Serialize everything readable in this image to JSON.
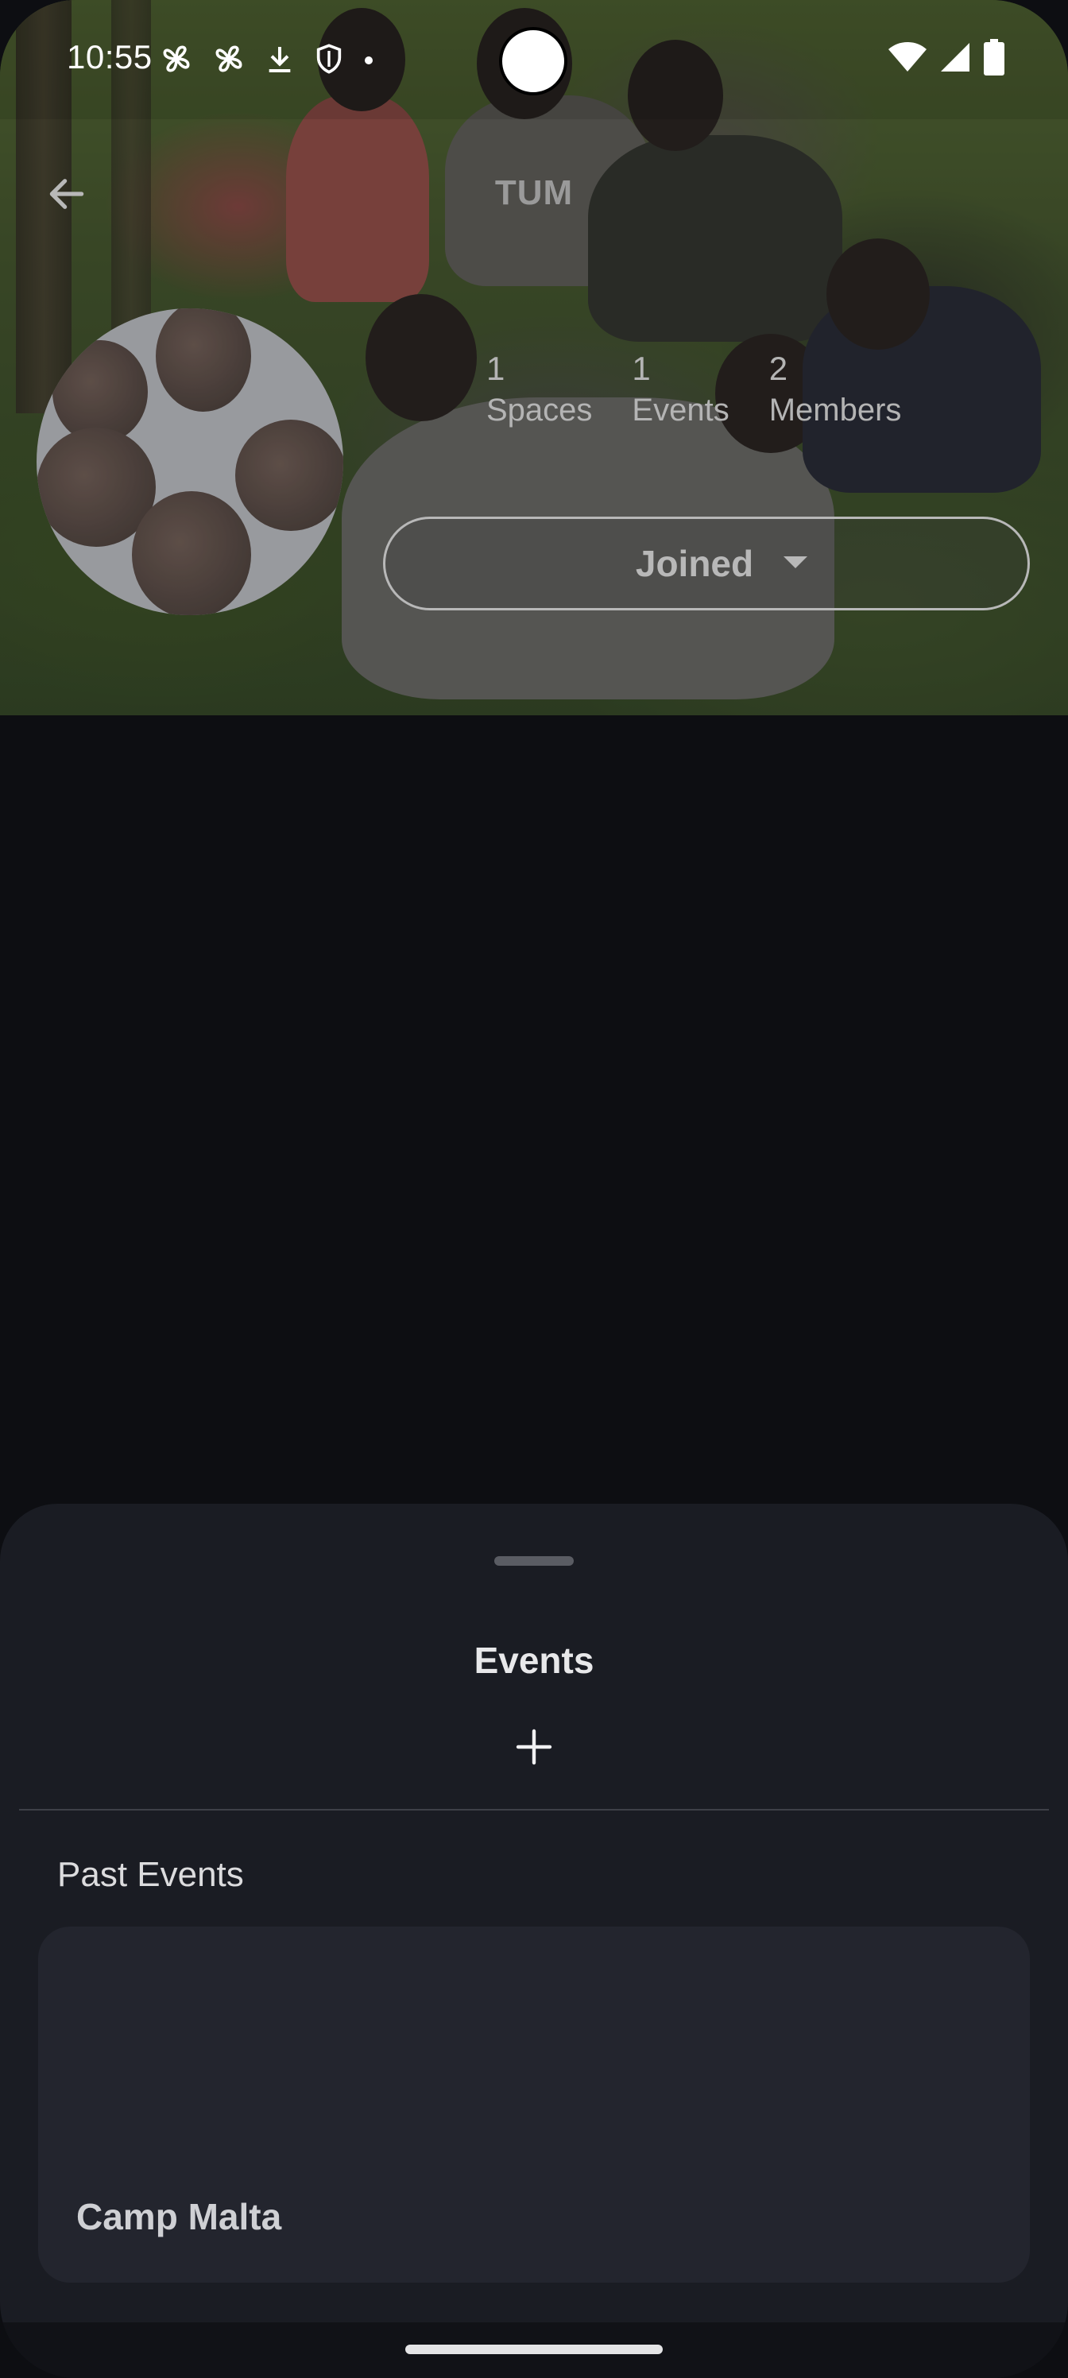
{
  "status_bar": {
    "time": "10:55",
    "left_icons": [
      "pinwheel-icon",
      "pinwheel-icon",
      "download-icon",
      "shield-icon",
      "dot-icon"
    ],
    "right_icons": [
      "wifi-icon",
      "signal-icon",
      "battery-icon"
    ]
  },
  "header": {
    "title": "TUM",
    "back_icon": "arrow-left-icon",
    "background": "group-photo"
  },
  "stats": [
    {
      "count": "1",
      "label": "Spaces"
    },
    {
      "count": "1",
      "label": "Events"
    },
    {
      "count": "2",
      "label": "Members"
    }
  ],
  "membership": {
    "label": "Joined",
    "icon": "caret-down-icon"
  },
  "sheet": {
    "title": "Events",
    "add_icon": "plus-icon",
    "section_label": "Past Events",
    "events": [
      {
        "name": "Camp Malta"
      }
    ]
  },
  "colors": {
    "background": "#0d0e12",
    "sheet": "#1a1c23",
    "card": "#23252e",
    "text_primary": "#e8e8ea",
    "text_muted": "#b4b4b4"
  }
}
